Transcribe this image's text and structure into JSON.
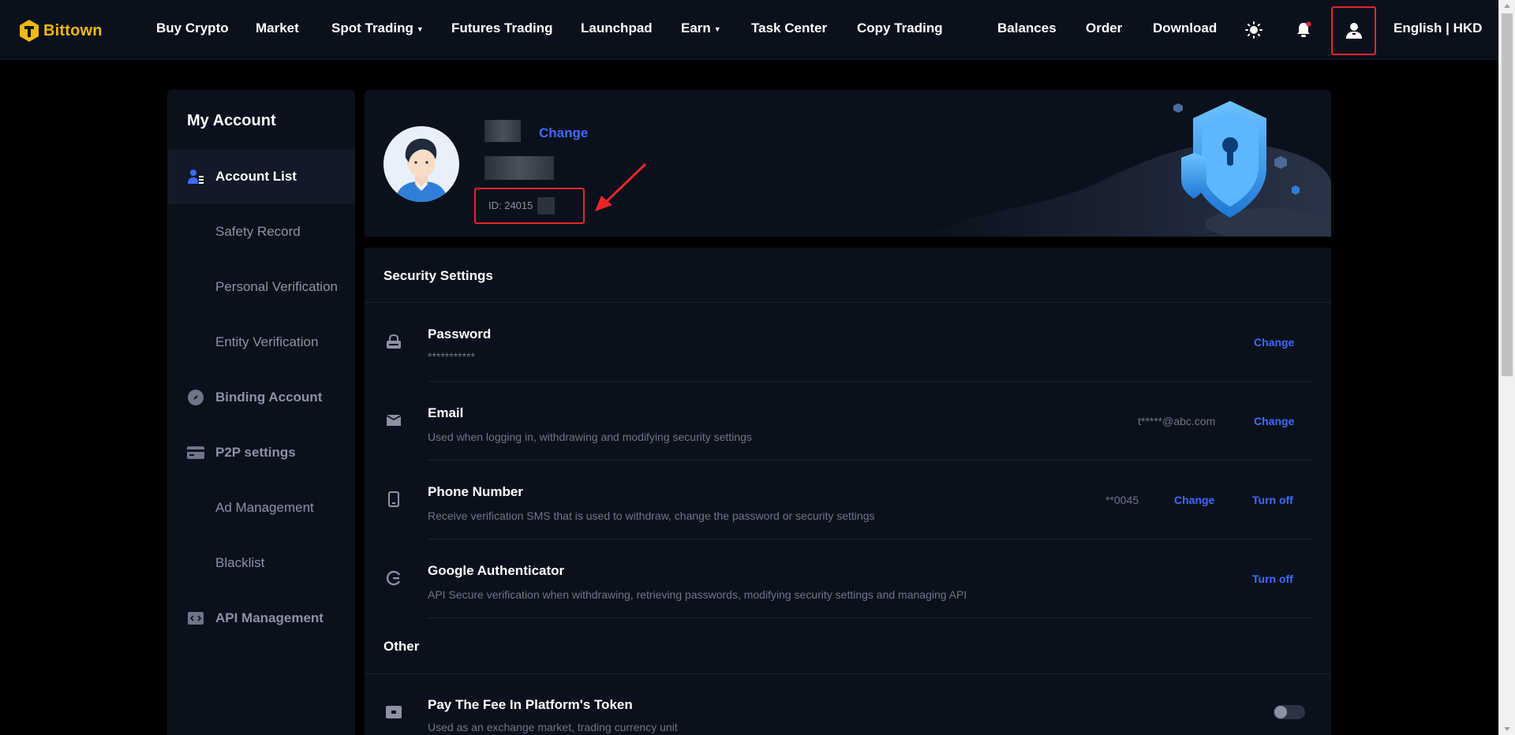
{
  "brand": {
    "name": "Bittown"
  },
  "nav": {
    "items": [
      "Buy Crypto",
      "Market",
      "Spot Trading",
      "Futures Trading",
      "Launchpad",
      "Earn",
      "Task Center",
      "Copy Trading"
    ],
    "right": [
      "Balances",
      "Order",
      "Download"
    ],
    "language": "English | HKD"
  },
  "sidebar": {
    "title": "My Account",
    "items": [
      {
        "label": "Account List",
        "icon": "user-list-icon"
      },
      {
        "label": "Safety Record"
      },
      {
        "label": "Personal Verification"
      },
      {
        "label": "Entity Verification"
      },
      {
        "label": "Binding Account",
        "icon": "compass-icon"
      },
      {
        "label": "P2P settings",
        "icon": "card-icon"
      },
      {
        "label": "Ad Management"
      },
      {
        "label": "Blacklist"
      },
      {
        "label": "API Management",
        "icon": "code-icon"
      }
    ]
  },
  "profile": {
    "change_label": "Change",
    "id_text": "ID: 24015"
  },
  "security": {
    "title": "Security Settings",
    "rows": [
      {
        "title": "Password",
        "desc": "***********",
        "value": "",
        "actions": [
          "Change"
        ]
      },
      {
        "title": "Email",
        "desc": "Used when logging in, withdrawing and modifying security settings",
        "value": "t*****@abc.com",
        "actions": [
          "Change"
        ]
      },
      {
        "title": "Phone Number",
        "desc": "Receive verification SMS that is used to withdraw, change the password or security settings",
        "value": "**0045",
        "actions": [
          "Change",
          "Turn off"
        ]
      },
      {
        "title": "Google Authenticator",
        "desc": "API Secure verification when withdrawing, retrieving passwords, modifying security settings and managing API",
        "value": "",
        "actions": [
          "Turn off"
        ]
      }
    ]
  },
  "other": {
    "title": "Other",
    "rows": [
      {
        "title": "Pay The Fee In Platform's Token",
        "desc": "Used as an exchange market, trading currency unit",
        "toggle_on": false
      }
    ]
  },
  "colors": {
    "accent": "#3b6cff",
    "brand": "#f0b90b",
    "highlight": "#e8252a"
  }
}
